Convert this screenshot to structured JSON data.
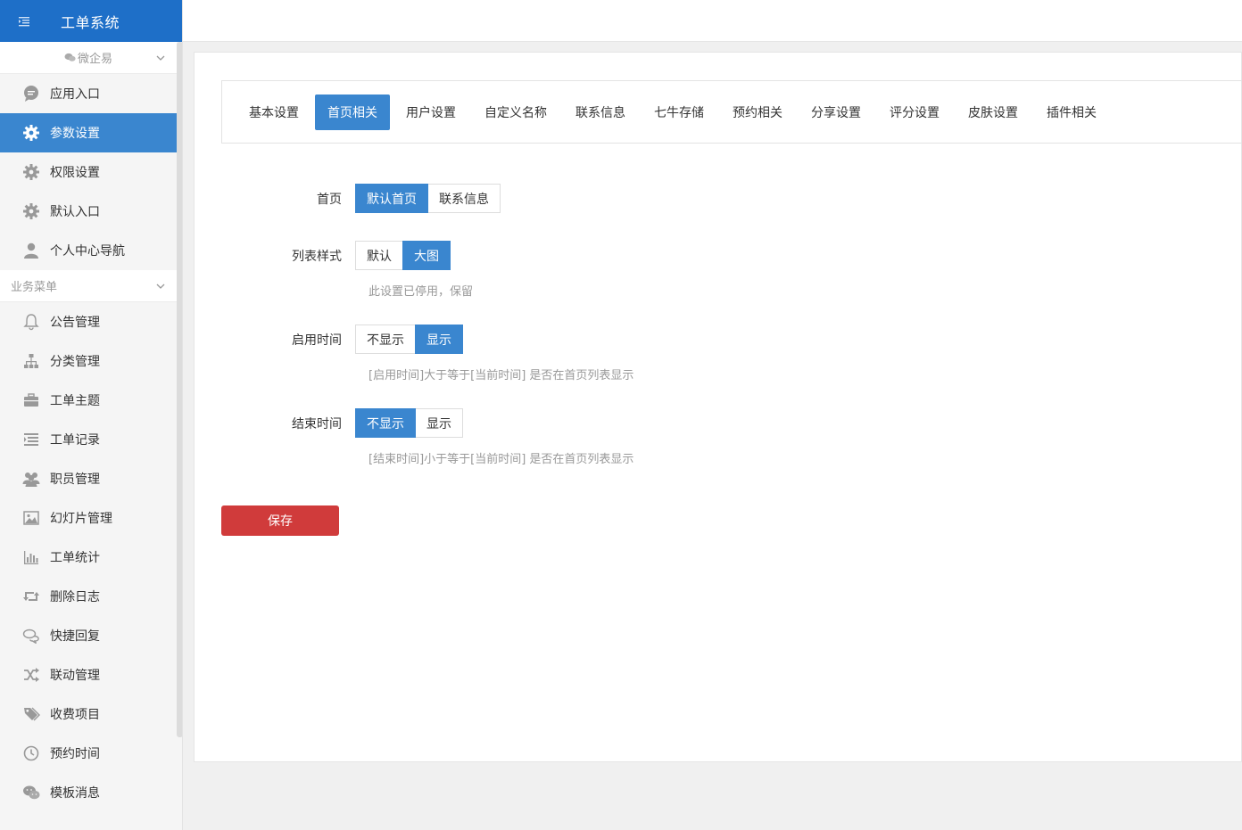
{
  "app": {
    "title": "工单系统"
  },
  "sidebar": {
    "group1": "微企易",
    "group2": "业务菜单",
    "items_top": [
      {
        "label": "应用入口",
        "icon": "chat-bubble-icon"
      },
      {
        "label": "参数设置",
        "icon": "gear-icon",
        "active": true
      },
      {
        "label": "权限设置",
        "icon": "gear-icon"
      },
      {
        "label": "默认入口",
        "icon": "gear-icon"
      },
      {
        "label": "个人中心导航",
        "icon": "user-icon"
      }
    ],
    "items_biz": [
      {
        "label": "公告管理",
        "icon": "bell-icon"
      },
      {
        "label": "分类管理",
        "icon": "sitemap-icon"
      },
      {
        "label": "工单主题",
        "icon": "briefcase-icon"
      },
      {
        "label": "工单记录",
        "icon": "list-icon"
      },
      {
        "label": "职员管理",
        "icon": "users-icon"
      },
      {
        "label": "幻灯片管理",
        "icon": "image-icon"
      },
      {
        "label": "工单统计",
        "icon": "bar-chart-icon"
      },
      {
        "label": "删除日志",
        "icon": "retweet-icon"
      },
      {
        "label": "快捷回复",
        "icon": "comments-icon"
      },
      {
        "label": "联动管理",
        "icon": "shuffle-icon"
      },
      {
        "label": "收费项目",
        "icon": "tags-icon"
      },
      {
        "label": "预约时间",
        "icon": "clock-icon"
      },
      {
        "label": "模板消息",
        "icon": "wechat-icon"
      }
    ]
  },
  "tabs": [
    "基本设置",
    "首页相关",
    "用户设置",
    "自定义名称",
    "联系信息",
    "七牛存储",
    "预约相关",
    "分享设置",
    "评分设置",
    "皮肤设置",
    "插件相关"
  ],
  "active_tab": "首页相关",
  "form": {
    "home": {
      "label": "首页",
      "options": [
        "默认首页",
        "联系信息"
      ],
      "selected": "默认首页"
    },
    "list_style": {
      "label": "列表样式",
      "options": [
        "默认",
        "大图"
      ],
      "selected": "大图",
      "hint": "此设置已停用，保留"
    },
    "start_time": {
      "label": "启用时间",
      "options": [
        "不显示",
        "显示"
      ],
      "selected": "显示",
      "hint": "[启用时间]大于等于[当前时间] 是否在首页列表显示"
    },
    "end_time": {
      "label": "结束时间",
      "options": [
        "不显示",
        "显示"
      ],
      "selected": "不显示",
      "hint": "[结束时间]小于等于[当前时间] 是否在首页列表显示"
    }
  },
  "save_label": "保存",
  "colors": {
    "brand": "#1e6fc8",
    "accent": "#3a86cf",
    "danger": "#d03b3b"
  }
}
